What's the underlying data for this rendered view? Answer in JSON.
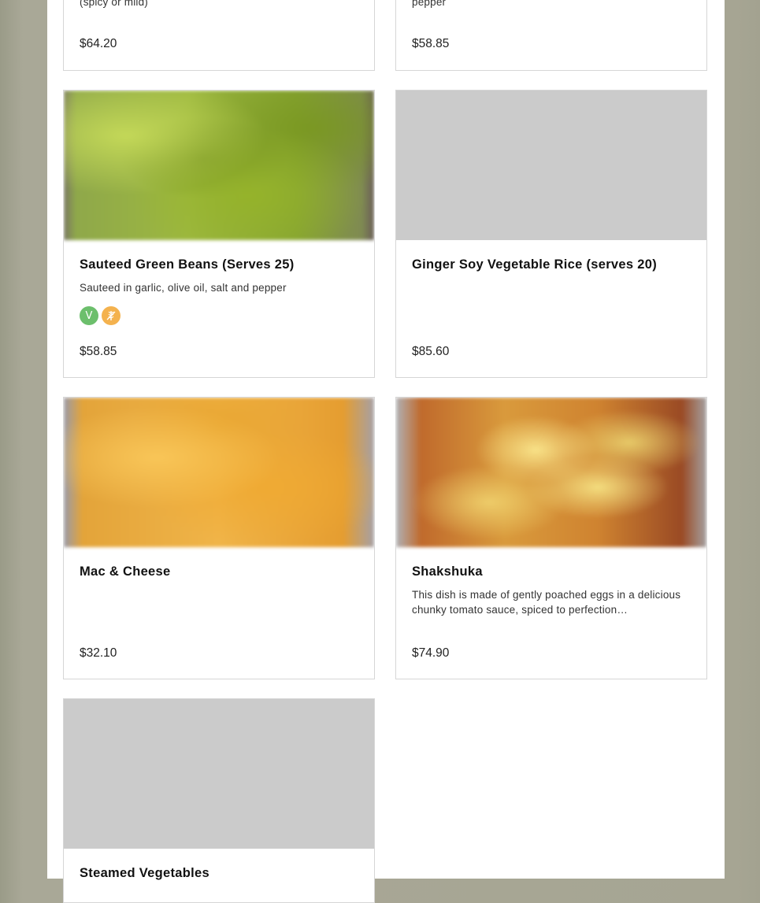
{
  "top_cards": [
    {
      "desc": "(spicy or mild)",
      "price": "$64.20"
    },
    {
      "desc": "pepper",
      "price": "$58.85"
    }
  ],
  "cards": [
    {
      "title": "Sauteed Green Beans (Serves 25)",
      "desc": "Sauteed in garlic, olive oil, salt and pepper",
      "tags": [
        "V",
        "GF"
      ],
      "price": "$58.85"
    },
    {
      "title": "Ginger Soy Vegetable Rice (serves 20)",
      "desc": "",
      "price": "$85.60"
    },
    {
      "title": "Mac & Cheese",
      "desc": "",
      "price": "$32.10"
    },
    {
      "title": "Shakshuka",
      "desc": "This dish is made of gently poached eggs in a delicious chunky tomato sauce, spiced to perfection…",
      "price": "$74.90"
    },
    {
      "title": "Steamed Vegetables"
    }
  ],
  "tag_labels": {
    "veg": "V",
    "gf_icon": "wheat-crossed-icon"
  },
  "colors": {
    "veg": "#6cbf6c",
    "gluten_free": "#f4b24e",
    "placeholder": "#cbcbcb"
  }
}
